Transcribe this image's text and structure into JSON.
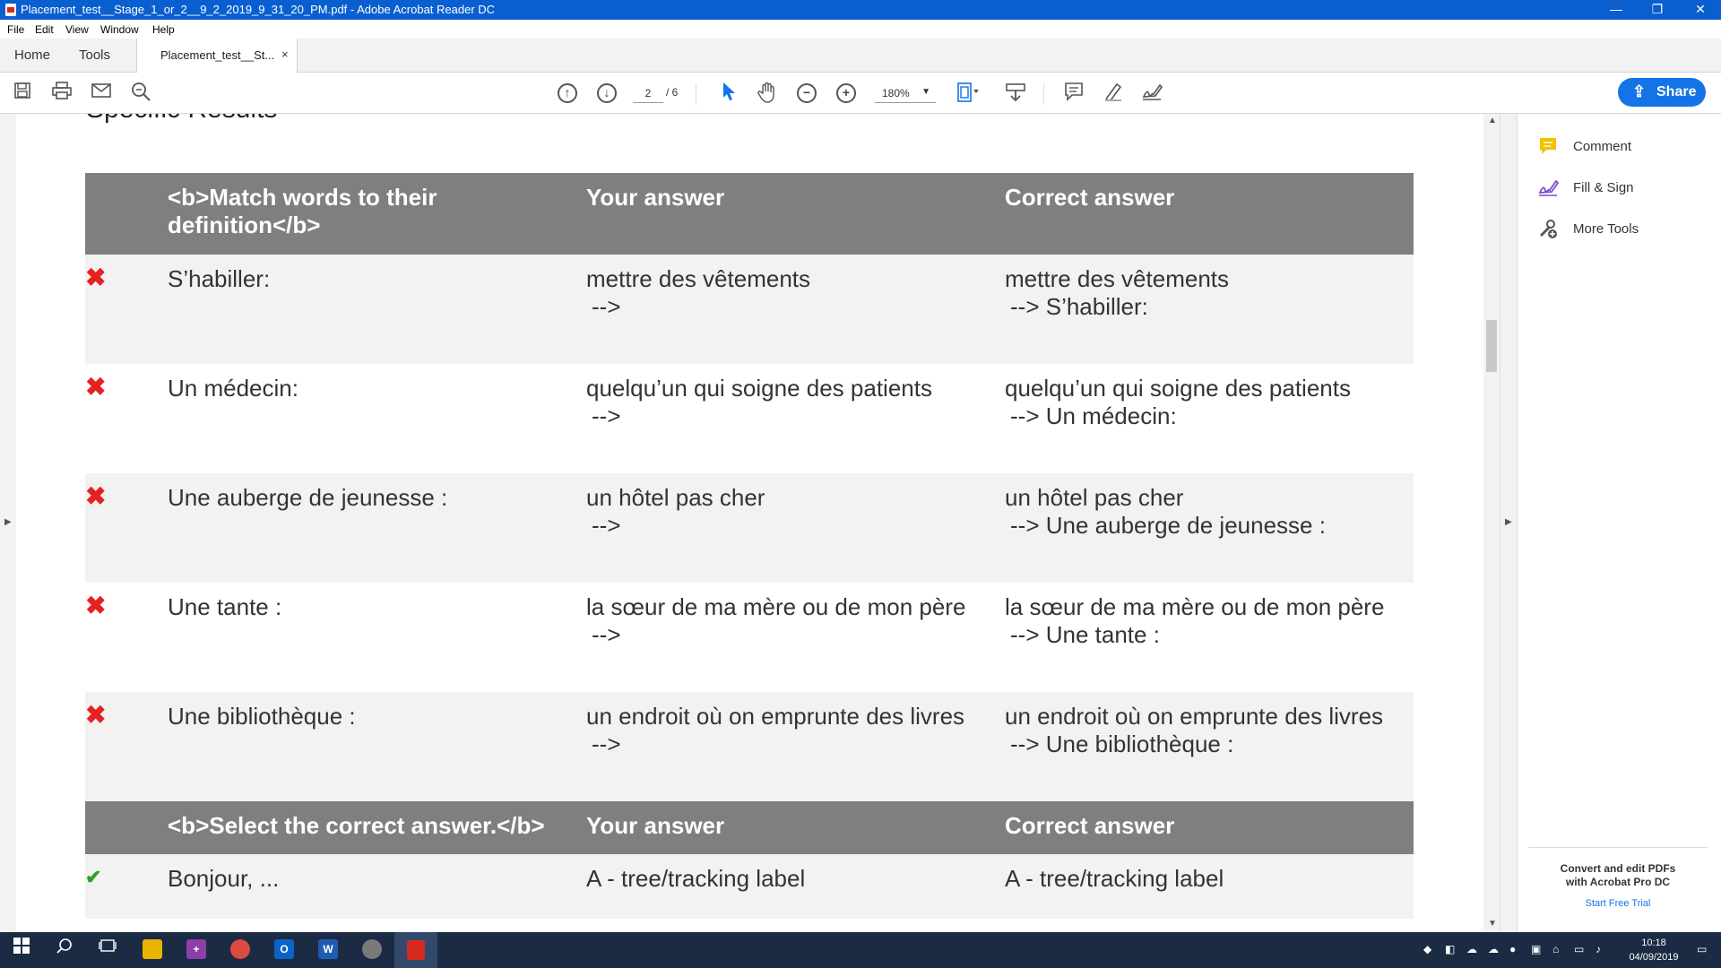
{
  "window": {
    "title": "Placement_test__Stage_1_or_2__9_2_2019_9_31_20_PM.pdf - Adobe Acrobat Reader DC",
    "minimize_glyph": "—",
    "maximize_glyph": "❐",
    "close_glyph": "✕"
  },
  "menu": [
    "File",
    "Edit",
    "View",
    "Window",
    "Help"
  ],
  "tabs": {
    "home": "Home",
    "tools": "Tools",
    "document": "Placement_test__St...",
    "close_glyph": "×"
  },
  "toolbar": {
    "page_current": "2",
    "page_total": "/ 6",
    "zoom": "180%",
    "share_label": "Share"
  },
  "document": {
    "heading": "Specific Results",
    "sections": [
      {
        "headers": [
          "",
          "<b>Match words to their definition</b>",
          "Your answer",
          "Correct answer"
        ],
        "rows": [
          {
            "status": "wrong",
            "mark": "✖",
            "question": "S’habiller:",
            "your": "mettre des vêtements",
            "your_sub": "-->",
            "correct": "mettre des vêtements",
            "correct_sub": "--> S’habiller:"
          },
          {
            "status": "wrong",
            "mark": "✖",
            "question": "Un médecin:",
            "your": "quelqu’un qui soigne des patients",
            "your_sub": "-->",
            "correct": "quelqu’un qui soigne des patients",
            "correct_sub": "--> Un médecin:"
          },
          {
            "status": "wrong",
            "mark": "✖",
            "question": "Une auberge de jeunesse :",
            "your": "un hôtel pas cher",
            "your_sub": "-->",
            "correct": "un hôtel pas cher",
            "correct_sub": "--> Une auberge de jeunesse :"
          },
          {
            "status": "wrong",
            "mark": "✖",
            "question": "Une tante :",
            "your": "la sœur de ma mère ou de mon père",
            "your_sub": "-->",
            "correct": "la sœur de ma mère ou de mon père",
            "correct_sub": "--> Une tante :"
          },
          {
            "status": "wrong",
            "mark": "✖",
            "question": "Une bibliothèque :",
            "your": "un endroit où on emprunte des livres",
            "your_sub": "-->",
            "correct": "un endroit où on emprunte des livres",
            "correct_sub": "--> Une bibliothèque :"
          }
        ]
      },
      {
        "headers": [
          "",
          "<b>Select the correct answer.</b>",
          "Your answer",
          "Correct answer"
        ],
        "rows": [
          {
            "status": "correct",
            "mark": "✔",
            "question": "Bonjour, ...",
            "your": "A - tree/tracking label",
            "correct": "A - tree/tracking label"
          }
        ]
      }
    ]
  },
  "right_pane": {
    "items": [
      {
        "label": "Comment",
        "icon": "comment-icon",
        "color": "#f2c100"
      },
      {
        "label": "Fill & Sign",
        "icon": "fill-sign-icon",
        "color": "#7b4fc8"
      },
      {
        "label": "More Tools",
        "icon": "more-tools-icon",
        "color": "#555555"
      }
    ],
    "promo_line1": "Convert and edit PDFs",
    "promo_line2": "with Acrobat Pro DC",
    "promo_link": "Start Free Trial"
  },
  "taskbar": {
    "time": "10:18",
    "date": "04/09/2019"
  },
  "colors": {
    "title_bar": "#0a5fd0",
    "share_button": "#1473e6",
    "header_row": "#7f7f7f",
    "wrong_mark": "#e52121",
    "correct_mark": "#29a329",
    "taskbar": "#1b2b44"
  }
}
